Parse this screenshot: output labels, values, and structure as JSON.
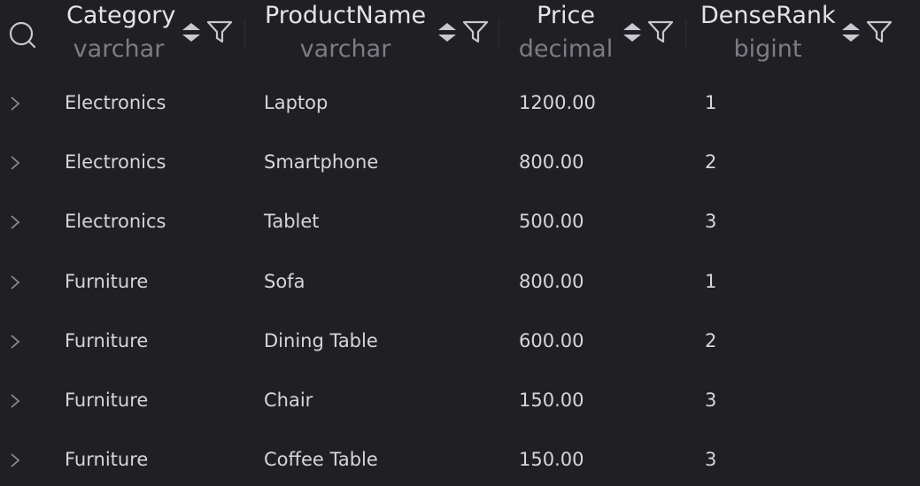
{
  "columns": [
    {
      "name": "Category",
      "type": "varchar"
    },
    {
      "name": "ProductName",
      "type": "varchar"
    },
    {
      "name": "Price",
      "type": "decimal"
    },
    {
      "name": "DenseRank",
      "type": "bigint"
    }
  ],
  "rows": [
    {
      "category": "Electronics",
      "product": "Laptop",
      "price": "1200.00",
      "rank": "1"
    },
    {
      "category": "Electronics",
      "product": "Smartphone",
      "price": "800.00",
      "rank": "2"
    },
    {
      "category": "Electronics",
      "product": "Tablet",
      "price": "500.00",
      "rank": "3"
    },
    {
      "category": "Furniture",
      "product": "Sofa",
      "price": "800.00",
      "rank": "1"
    },
    {
      "category": "Furniture",
      "product": "Dining Table",
      "price": "600.00",
      "rank": "2"
    },
    {
      "category": "Furniture",
      "product": "Chair",
      "price": "150.00",
      "rank": "3"
    },
    {
      "category": "Furniture",
      "product": "Coffee Table",
      "price": "150.00",
      "rank": "3"
    }
  ],
  "icons": {
    "search": "search-icon",
    "sort": "sort-icon",
    "filter": "filter-icon",
    "expand": "chevron-right-icon"
  },
  "colors": {
    "background": "#1f1f24",
    "header_text": "#e4e4e8",
    "type_text": "#7c7c84",
    "cell_text": "#d6d6da",
    "icon": "#c8c8d0"
  }
}
